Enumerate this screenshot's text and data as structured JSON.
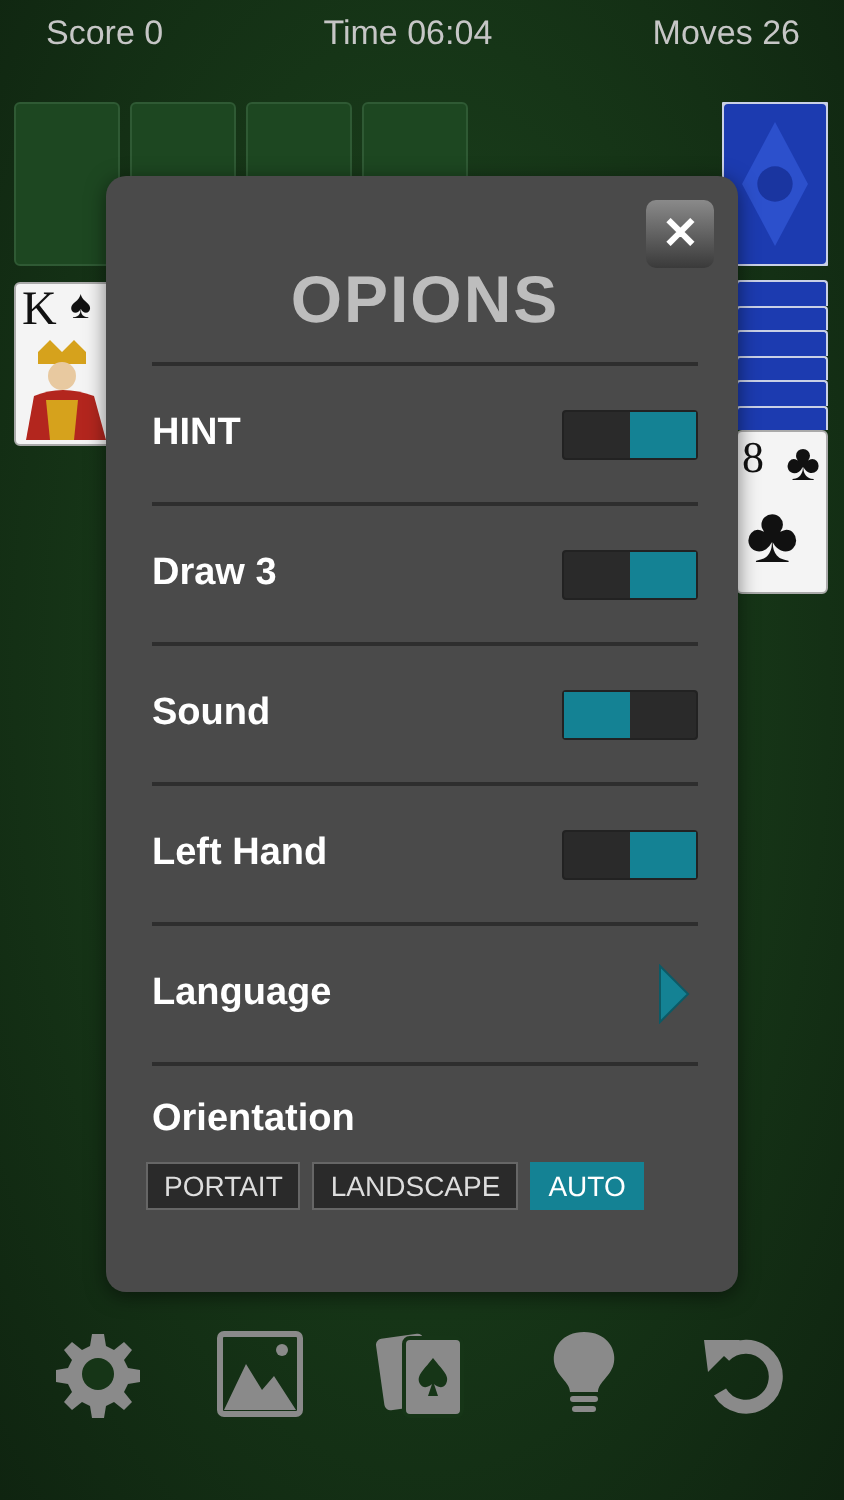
{
  "status_bar": {
    "score": "Score 0",
    "time": "Time 06:04",
    "moves": "Moves 26"
  },
  "board": {
    "king_card": {
      "rank": "K",
      "suit": "♠"
    },
    "club_card": {
      "rank": "8",
      "suit": "♣"
    }
  },
  "dialog": {
    "title": "OPIONS",
    "close": "✕",
    "rows": [
      {
        "kind": "toggle",
        "label": "HINT",
        "on": true
      },
      {
        "kind": "toggle",
        "label": "Draw 3",
        "on": true
      },
      {
        "kind": "toggle",
        "label": "Sound",
        "on": false
      },
      {
        "kind": "toggle",
        "label": "Left Hand",
        "on": true
      },
      {
        "kind": "arrow",
        "label": "Language"
      },
      {
        "kind": "choices",
        "label": "Orientation",
        "options": [
          {
            "label": "PORTAIT",
            "selected": false
          },
          {
            "label": "LANDSCAPE",
            "selected": false
          },
          {
            "label": "AUTO",
            "selected": true
          }
        ]
      }
    ]
  },
  "toolbar": [
    {
      "kind": "settings"
    },
    {
      "kind": "background"
    },
    {
      "kind": "cards"
    },
    {
      "kind": "hint"
    },
    {
      "kind": "undo"
    }
  ]
}
